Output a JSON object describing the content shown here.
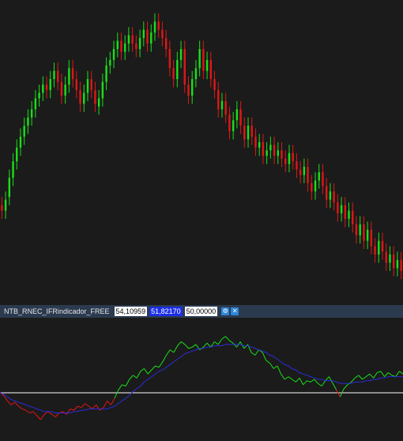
{
  "colors": {
    "background": "#1b1b1b",
    "bull": "#19e019",
    "bear": "#e01616",
    "signal_line": "#2b2bd8",
    "level_line": "#ffffff",
    "header_bar": "#2b3a4f"
  },
  "indicator": {
    "name": "NTB_RNEC_IFRindicador_FREE",
    "value_1": "54,10959",
    "value_2": "51,82170",
    "value_3": "50,00000",
    "icons": [
      "settings-icon",
      "close-icon"
    ]
  },
  "chart_data": [
    {
      "type": "candlestick",
      "candles": [
        {
          "o": 212,
          "c": 208
        },
        {
          "o": 208,
          "c": 216
        },
        {
          "o": 218,
          "c": 232
        },
        {
          "o": 232,
          "c": 244
        },
        {
          "o": 244,
          "c": 254
        },
        {
          "o": 254,
          "c": 262
        },
        {
          "o": 262,
          "c": 270
        },
        {
          "o": 270,
          "c": 276
        },
        {
          "o": 276,
          "c": 282
        },
        {
          "o": 282,
          "c": 290
        },
        {
          "o": 290,
          "c": 294
        },
        {
          "o": 294,
          "c": 300
        },
        {
          "o": 300,
          "c": 296
        },
        {
          "o": 296,
          "c": 304
        },
        {
          "o": 304,
          "c": 310
        },
        {
          "o": 310,
          "c": 302
        },
        {
          "o": 302,
          "c": 292
        },
        {
          "o": 292,
          "c": 300
        },
        {
          "o": 300,
          "c": 312
        },
        {
          "o": 312,
          "c": 304
        },
        {
          "o": 304,
          "c": 296
        },
        {
          "o": 296,
          "c": 286
        },
        {
          "o": 286,
          "c": 294
        },
        {
          "o": 294,
          "c": 304
        },
        {
          "o": 304,
          "c": 296
        },
        {
          "o": 296,
          "c": 286
        },
        {
          "o": 284,
          "c": 290
        },
        {
          "o": 290,
          "c": 302
        },
        {
          "o": 302,
          "c": 314
        },
        {
          "o": 314,
          "c": 318
        },
        {
          "o": 318,
          "c": 326
        },
        {
          "o": 326,
          "c": 332
        },
        {
          "o": 332,
          "c": 324
        },
        {
          "o": 324,
          "c": 330
        },
        {
          "o": 330,
          "c": 336
        },
        {
          "o": 336,
          "c": 330
        },
        {
          "o": 330,
          "c": 326
        },
        {
          "o": 326,
          "c": 334
        },
        {
          "o": 334,
          "c": 340
        },
        {
          "o": 340,
          "c": 330
        },
        {
          "o": 330,
          "c": 338
        },
        {
          "o": 338,
          "c": 346
        },
        {
          "o": 346,
          "c": 340
        },
        {
          "o": 340,
          "c": 334
        },
        {
          "o": 334,
          "c": 326
        },
        {
          "o": 326,
          "c": 312
        },
        {
          "o": 312,
          "c": 304
        },
        {
          "o": 304,
          "c": 318
        },
        {
          "o": 318,
          "c": 326
        },
        {
          "o": 326,
          "c": 300
        },
        {
          "o": 300,
          "c": 292
        },
        {
          "o": 292,
          "c": 304
        },
        {
          "o": 304,
          "c": 312
        },
        {
          "o": 312,
          "c": 326
        },
        {
          "o": 326,
          "c": 310
        },
        {
          "o": 310,
          "c": 318
        },
        {
          "o": 318,
          "c": 304
        },
        {
          "o": 304,
          "c": 296
        },
        {
          "o": 296,
          "c": 282
        },
        {
          "o": 282,
          "c": 288
        },
        {
          "o": 288,
          "c": 278
        },
        {
          "o": 278,
          "c": 266
        },
        {
          "o": 266,
          "c": 274
        },
        {
          "o": 274,
          "c": 282
        },
        {
          "o": 282,
          "c": 270
        },
        {
          "o": 270,
          "c": 260
        },
        {
          "o": 260,
          "c": 270
        },
        {
          "o": 270,
          "c": 262
        },
        {
          "o": 262,
          "c": 254
        },
        {
          "o": 254,
          "c": 258
        },
        {
          "o": 258,
          "c": 248
        },
        {
          "o": 248,
          "c": 252
        },
        {
          "o": 252,
          "c": 256
        },
        {
          "o": 256,
          "c": 248
        },
        {
          "o": 248,
          "c": 252
        },
        {
          "o": 252,
          "c": 246
        },
        {
          "o": 246,
          "c": 242
        },
        {
          "o": 242,
          "c": 250
        },
        {
          "o": 250,
          "c": 244
        },
        {
          "o": 244,
          "c": 238
        },
        {
          "o": 238,
          "c": 234
        },
        {
          "o": 234,
          "c": 240
        },
        {
          "o": 240,
          "c": 228
        },
        {
          "o": 228,
          "c": 222
        },
        {
          "o": 222,
          "c": 230
        },
        {
          "o": 230,
          "c": 236
        },
        {
          "o": 236,
          "c": 226
        },
        {
          "o": 226,
          "c": 216
        },
        {
          "o": 216,
          "c": 222
        },
        {
          "o": 222,
          "c": 214
        },
        {
          "o": 214,
          "c": 206
        },
        {
          "o": 206,
          "c": 212
        },
        {
          "o": 212,
          "c": 202
        },
        {
          "o": 202,
          "c": 208
        },
        {
          "o": 208,
          "c": 198
        },
        {
          "o": 198,
          "c": 190
        },
        {
          "o": 190,
          "c": 198
        },
        {
          "o": 198,
          "c": 186
        },
        {
          "o": 186,
          "c": 194
        },
        {
          "o": 194,
          "c": 182
        },
        {
          "o": 182,
          "c": 176
        },
        {
          "o": 176,
          "c": 186
        },
        {
          "o": 186,
          "c": 178
        },
        {
          "o": 178,
          "c": 170
        },
        {
          "o": 170,
          "c": 176
        },
        {
          "o": 176,
          "c": 166
        },
        {
          "o": 166,
          "c": 172
        },
        {
          "o": 172,
          "c": 164
        }
      ]
    },
    {
      "type": "line",
      "level": 50,
      "series": [
        {
          "color_role": "main",
          "values": [
            50,
            48,
            44,
            41,
            43,
            40,
            38,
            37,
            35,
            36,
            33,
            30,
            34,
            36,
            34,
            32,
            35,
            36,
            34,
            38,
            37,
            40,
            39,
            42,
            40,
            38,
            41,
            37,
            39,
            44,
            41,
            46,
            52,
            56,
            55,
            60,
            63,
            61,
            66,
            68,
            64,
            67,
            70,
            69,
            73,
            78,
            82,
            80,
            85,
            88,
            86,
            83,
            84,
            86,
            82,
            84,
            87,
            84,
            88,
            86,
            90,
            92,
            89,
            87,
            84,
            88,
            83,
            86,
            80,
            78,
            82,
            80,
            74,
            72,
            68,
            70,
            64,
            60,
            62,
            60,
            58,
            61,
            56,
            59,
            58,
            60,
            57,
            55,
            59,
            62,
            57,
            52,
            47,
            53,
            56,
            58,
            61,
            63,
            60,
            62,
            64,
            61,
            65,
            66,
            62,
            65,
            63,
            62,
            66,
            64
          ]
        },
        {
          "color_role": "signal",
          "values": [
            50,
            49,
            47,
            45,
            44,
            43,
            42,
            41,
            40,
            39,
            38,
            37,
            36,
            36,
            36,
            35,
            35,
            35,
            35,
            35,
            36,
            36,
            37,
            37,
            38,
            38,
            38,
            38,
            38,
            38,
            39,
            40,
            42,
            44,
            46,
            48,
            51,
            53,
            55,
            58,
            60,
            62,
            64,
            66,
            67,
            69,
            71,
            73,
            75,
            77,
            79,
            80,
            81,
            82,
            83,
            83,
            84,
            84,
            85,
            85,
            85,
            86,
            86,
            86,
            86,
            86,
            85,
            85,
            84,
            83,
            82,
            81,
            80,
            78,
            77,
            75,
            73,
            71,
            70,
            68,
            67,
            65,
            64,
            63,
            62,
            61,
            60,
            60,
            59,
            59,
            59,
            58,
            57,
            57,
            57,
            57,
            58,
            58,
            58,
            59,
            59,
            60,
            60,
            61,
            61,
            62,
            62,
            62,
            62,
            62
          ]
        }
      ]
    }
  ]
}
